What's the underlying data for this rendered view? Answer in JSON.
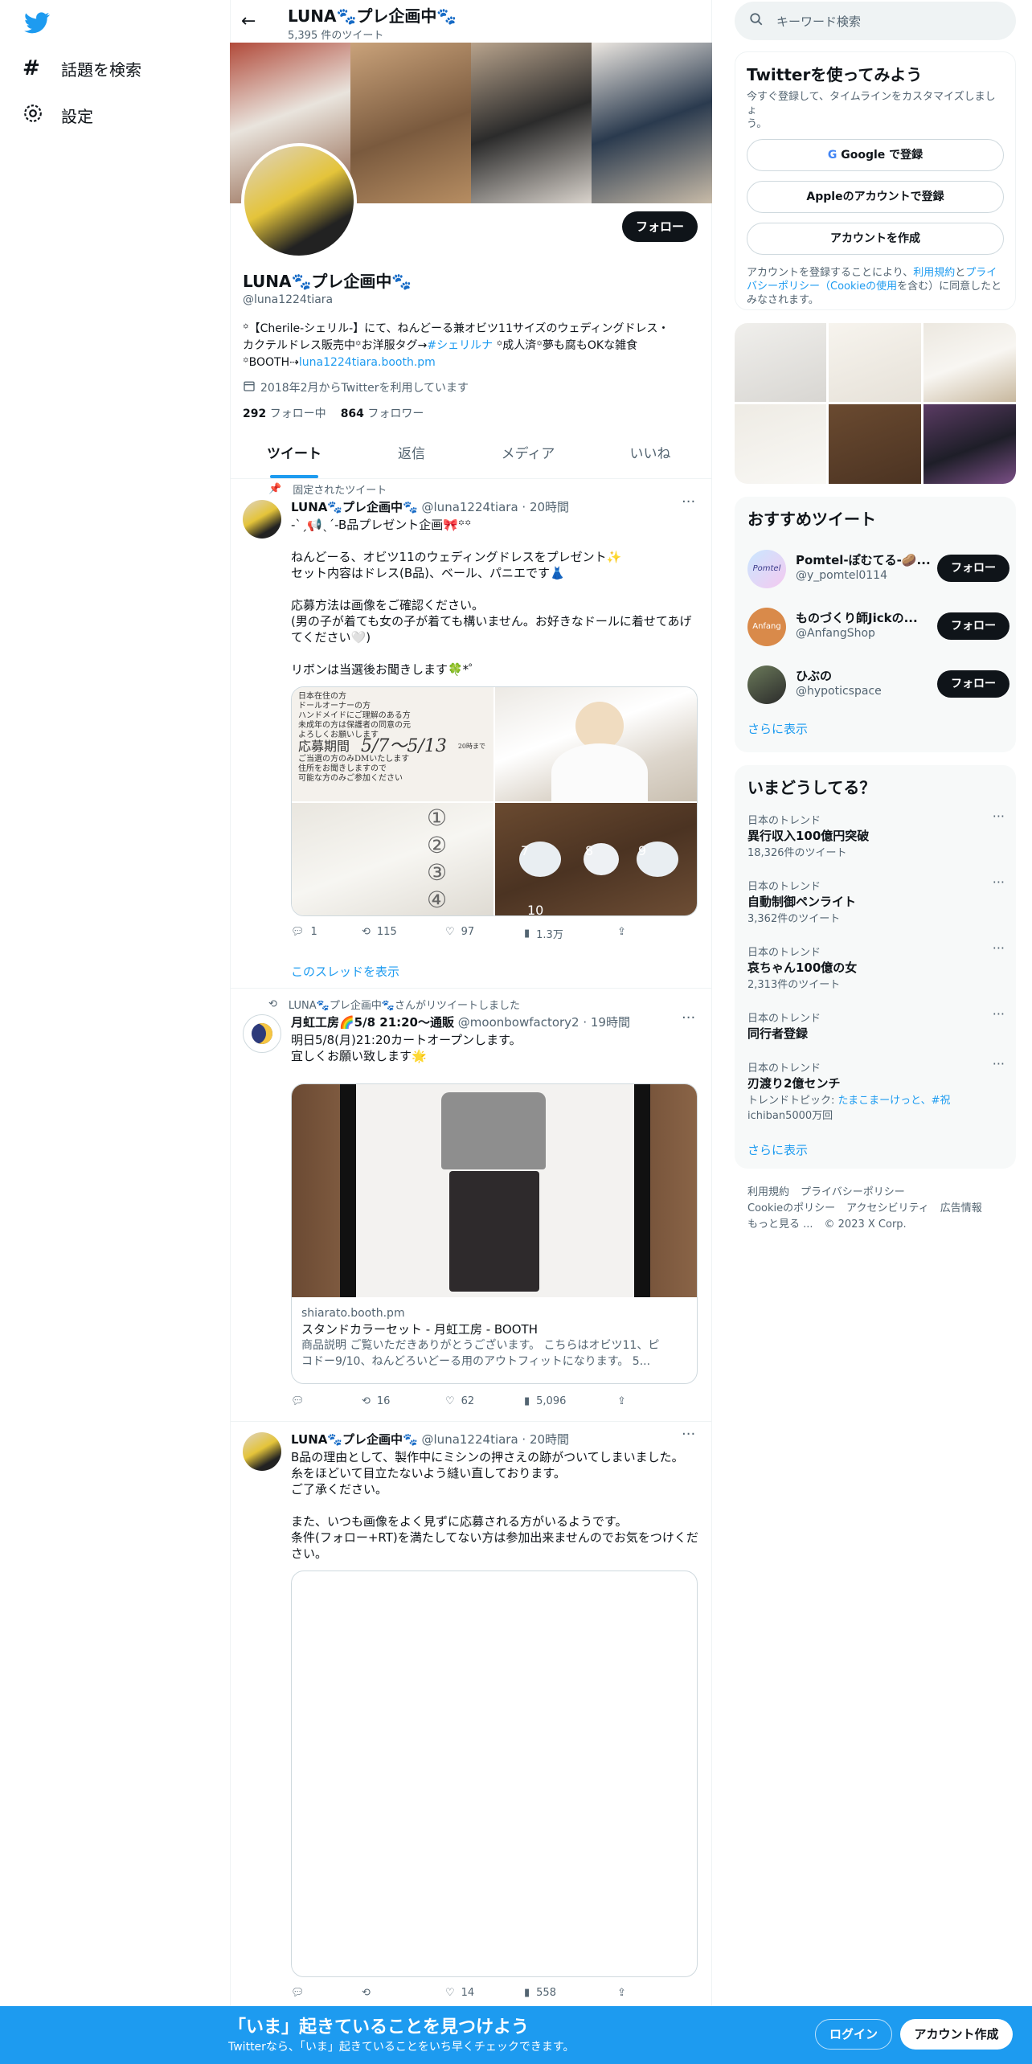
{
  "nav": {
    "search_label": "話題を検索",
    "settings_label": "設定"
  },
  "header": {
    "name": "LUNA🐾プレ企画中🐾",
    "tweet_count": "5,395 件のツイート"
  },
  "profile": {
    "name": "LUNA🐾プレ企画中🐾",
    "handle": "@luna1224tiara",
    "follow_label": "フォロー",
    "bio_1": "꙳【Cherile-シェリル-】にて、ねんどーる兼オビツ11サイズのウェディングドレス・",
    "bio_2a": "カクテルドレス販売中꙳お洋服タグ→",
    "bio_2_link": "#シェリルナ",
    "bio_2b": " ꙳成人済꙳夢も腐もOKな雑食",
    "bio_3a": "꙳BOOTH⇢",
    "bio_3_link": "luna1224tiara.booth.pm",
    "joined": "2018年2月からTwitterを利用しています",
    "following_count": "292",
    "following_label": "フォロー中",
    "followers_count": "864",
    "followers_label": "フォロワー"
  },
  "tabs": [
    "ツイート",
    "返信",
    "メディア",
    "いいね"
  ],
  "tweet1": {
    "pinned_label": "固定されたツイート",
    "name": "LUNA🐾プレ企画中🐾",
    "handle": "@luna1224tiara · 20時間",
    "lines": [
      "-ˋˏ📢ˎˊ-B品プレゼント企画🎀꙳꙳",
      "",
      "ねんどーる、オビツ11のウェディングドレスをプレゼント✨",
      "セット内容はドレス(B品)、ベール、パニエです👗",
      "",
      "応募方法は画像をご確認ください。",
      "(男の子が着ても女の子が着ても構いません。お好きなドールに着せてあげ",
      "てください🤍)",
      "",
      "リボンは当選後お聞きします🍀*゜"
    ],
    "img1_lines": [
      "日本在住の方",
      "ドールオーナーの方",
      "ハンドメイドにご理解のある方",
      "未成年の方は保護者の同意の元",
      "よろしくお願いします",
      "応募期間",
      "5/7〜5/13",
      "20時まで",
      "ご当選の方のみDMいたします",
      "住所をお聞きしますので",
      "可能な方のみご参加ください"
    ],
    "img3_nums": [
      "①",
      "②",
      "③",
      "④"
    ],
    "img4_nums": [
      "7",
      "8",
      "9",
      "10"
    ],
    "replies": "1",
    "retweets": "115",
    "likes": "97",
    "views": "1.3万",
    "thread_label": "このスレッドを表示"
  },
  "tweet2": {
    "retweet_label": "LUNA🐾プレ企画中🐾さんがリツイートしました",
    "name": "月虹工房🌈5/8 21:20〜通販",
    "handle": "@moonbowfactory2 · 19時間",
    "lines": [
      "明日5/8(月)21:20カートオープンします。",
      "宜しくお願い致します🌟"
    ],
    "card_domain": "shiarato.booth.pm",
    "card_title": "スタンドカラーセット - 月虹工房 - BOOTH",
    "card_desc_1": "商品説明 ご覧いただきありがとうございます。 こちらはオビツ11、ピ",
    "card_desc_2": "コドー9/10、ねんどろいどーる用のアウトフィットになります。 5...",
    "replies": "",
    "retweets": "16",
    "likes": "62",
    "views": "5,096"
  },
  "tweet3": {
    "name": "LUNA🐾プレ企画中🐾",
    "handle": "@luna1224tiara · 20時間",
    "lines": [
      "B品の理由として、製作中にミシンの押さえの跡がついてしまいました。",
      "糸をほどいて目立たないよう縫い直しております。",
      "ご了承ください。",
      "",
      "また、いつも画像をよく見ずに応募される方がいるようです。",
      "条件(フォロー+RT)を満たしてない方は参加出来ませんのでお気をつけくだ",
      "さい。"
    ],
    "replies": "",
    "retweets": "",
    "likes": "14",
    "views": "558"
  },
  "right": {
    "search_placeholder": "キーワード検索",
    "signup_title": "Twitterを使ってみよう",
    "signup_sub_1": "今すぐ登録して、タイムラインをカスタマイズしましょ",
    "signup_sub_2": "う。",
    "google_label": "Google で登録",
    "apple_label": "Appleのアカウントで登録",
    "create_label": "アカウントを作成",
    "terms_1a": "アカウントを登録することにより、",
    "terms_1_link": "利用規約",
    "terms_1b": "と",
    "terms_1_link2": "プライ",
    "terms_2_link": "バシーポリシー（Cookieの使用",
    "terms_2b": "を含む）に同意したと",
    "terms_3": "みなされます。",
    "recommended_title": "おすすめツイート",
    "recommended": [
      {
        "name": "Pomtel-ぽむてる-🥔...",
        "handle": "@y_pomtel0114",
        "follow": "フォロー"
      },
      {
        "name": "ものづくり師Jickの...",
        "handle": "@AnfangShop",
        "follow": "フォロー"
      },
      {
        "name": "ひぶの",
        "handle": "@hypoticspace",
        "follow": "フォロー"
      }
    ],
    "show_more": "さらに表示",
    "trends_title": "いまどうしてる？",
    "trends": [
      {
        "meta": "日本のトレンド",
        "name": "異行収入100億円突破",
        "count": "18,326件のツイート"
      },
      {
        "meta": "日本のトレンド",
        "name": "自動制御ペンライト",
        "count": "3,362件のツイート"
      },
      {
        "meta": "日本のトレンド",
        "name": "哀ちゃん100億の女",
        "count": "2,313件のツイート"
      },
      {
        "meta": "日本のトレンド",
        "name": "同行者登録",
        "count": ""
      },
      {
        "meta": "日本のトレンド",
        "name": "刃渡り2億センチ",
        "count": ""
      }
    ],
    "trend5_topic_a": "トレンドトピック: ",
    "trend5_topic_link1": "たまこまーけっと、#祝",
    "trend5_topic_link2": "ichiban5000万回",
    "trends_more": "さらに表示",
    "footer": [
      "利用規約",
      "プライバシーポリシー",
      "Cookieのポリシー",
      "アクセシビリティ",
      "広告情報",
      "もっと見る ...",
      "© 2023 X Corp."
    ]
  },
  "banner": {
    "title": "「いま」起きていることを見つけよう",
    "sub": "Twitterなら、「いま」起きていることをいち早くチェックできます。",
    "login": "ログイン",
    "signup": "アカウント作成"
  },
  "colors": {
    "twitter_blue": "#1d9bf0",
    "banner_bg": "#1d9bf0",
    "dark": "#0f1419"
  }
}
